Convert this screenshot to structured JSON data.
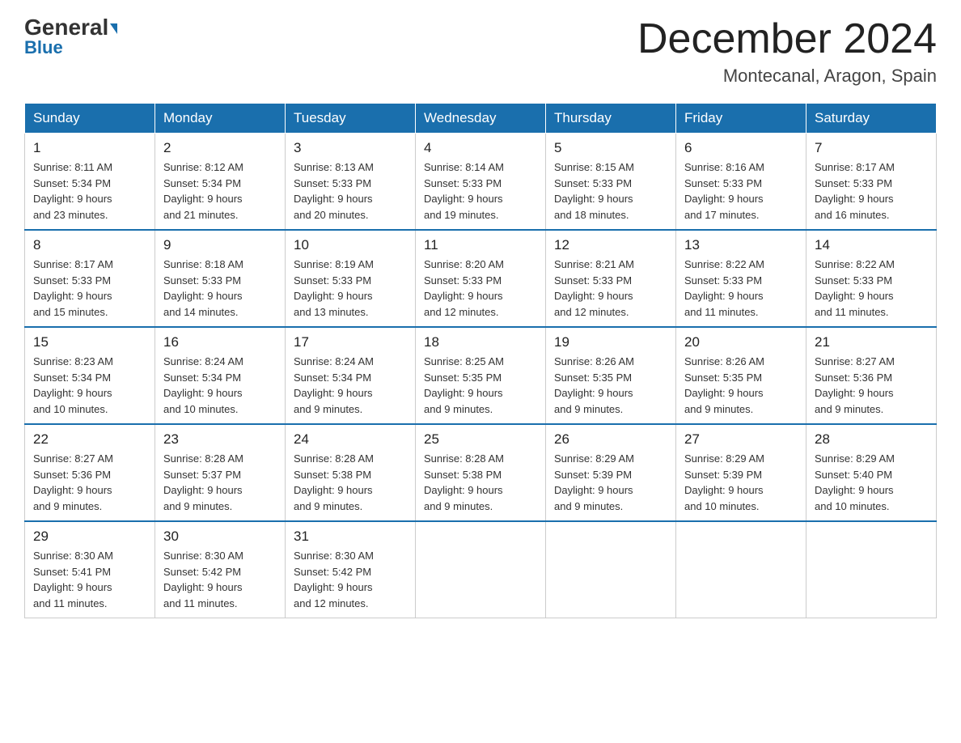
{
  "header": {
    "logo_general": "General",
    "logo_blue": "Blue",
    "month_title": "December 2024",
    "location": "Montecanal, Aragon, Spain"
  },
  "days_of_week": [
    "Sunday",
    "Monday",
    "Tuesday",
    "Wednesday",
    "Thursday",
    "Friday",
    "Saturday"
  ],
  "weeks": [
    [
      {
        "day": "1",
        "sunrise": "8:11 AM",
        "sunset": "5:34 PM",
        "daylight": "9 hours and 23 minutes."
      },
      {
        "day": "2",
        "sunrise": "8:12 AM",
        "sunset": "5:34 PM",
        "daylight": "9 hours and 21 minutes."
      },
      {
        "day": "3",
        "sunrise": "8:13 AM",
        "sunset": "5:33 PM",
        "daylight": "9 hours and 20 minutes."
      },
      {
        "day": "4",
        "sunrise": "8:14 AM",
        "sunset": "5:33 PM",
        "daylight": "9 hours and 19 minutes."
      },
      {
        "day": "5",
        "sunrise": "8:15 AM",
        "sunset": "5:33 PM",
        "daylight": "9 hours and 18 minutes."
      },
      {
        "day": "6",
        "sunrise": "8:16 AM",
        "sunset": "5:33 PM",
        "daylight": "9 hours and 17 minutes."
      },
      {
        "day": "7",
        "sunrise": "8:17 AM",
        "sunset": "5:33 PM",
        "daylight": "9 hours and 16 minutes."
      }
    ],
    [
      {
        "day": "8",
        "sunrise": "8:17 AM",
        "sunset": "5:33 PM",
        "daylight": "9 hours and 15 minutes."
      },
      {
        "day": "9",
        "sunrise": "8:18 AM",
        "sunset": "5:33 PM",
        "daylight": "9 hours and 14 minutes."
      },
      {
        "day": "10",
        "sunrise": "8:19 AM",
        "sunset": "5:33 PM",
        "daylight": "9 hours and 13 minutes."
      },
      {
        "day": "11",
        "sunrise": "8:20 AM",
        "sunset": "5:33 PM",
        "daylight": "9 hours and 12 minutes."
      },
      {
        "day": "12",
        "sunrise": "8:21 AM",
        "sunset": "5:33 PM",
        "daylight": "9 hours and 12 minutes."
      },
      {
        "day": "13",
        "sunrise": "8:22 AM",
        "sunset": "5:33 PM",
        "daylight": "9 hours and 11 minutes."
      },
      {
        "day": "14",
        "sunrise": "8:22 AM",
        "sunset": "5:33 PM",
        "daylight": "9 hours and 11 minutes."
      }
    ],
    [
      {
        "day": "15",
        "sunrise": "8:23 AM",
        "sunset": "5:34 PM",
        "daylight": "9 hours and 10 minutes."
      },
      {
        "day": "16",
        "sunrise": "8:24 AM",
        "sunset": "5:34 PM",
        "daylight": "9 hours and 10 minutes."
      },
      {
        "day": "17",
        "sunrise": "8:24 AM",
        "sunset": "5:34 PM",
        "daylight": "9 hours and 9 minutes."
      },
      {
        "day": "18",
        "sunrise": "8:25 AM",
        "sunset": "5:35 PM",
        "daylight": "9 hours and 9 minutes."
      },
      {
        "day": "19",
        "sunrise": "8:26 AM",
        "sunset": "5:35 PM",
        "daylight": "9 hours and 9 minutes."
      },
      {
        "day": "20",
        "sunrise": "8:26 AM",
        "sunset": "5:35 PM",
        "daylight": "9 hours and 9 minutes."
      },
      {
        "day": "21",
        "sunrise": "8:27 AM",
        "sunset": "5:36 PM",
        "daylight": "9 hours and 9 minutes."
      }
    ],
    [
      {
        "day": "22",
        "sunrise": "8:27 AM",
        "sunset": "5:36 PM",
        "daylight": "9 hours and 9 minutes."
      },
      {
        "day": "23",
        "sunrise": "8:28 AM",
        "sunset": "5:37 PM",
        "daylight": "9 hours and 9 minutes."
      },
      {
        "day": "24",
        "sunrise": "8:28 AM",
        "sunset": "5:38 PM",
        "daylight": "9 hours and 9 minutes."
      },
      {
        "day": "25",
        "sunrise": "8:28 AM",
        "sunset": "5:38 PM",
        "daylight": "9 hours and 9 minutes."
      },
      {
        "day": "26",
        "sunrise": "8:29 AM",
        "sunset": "5:39 PM",
        "daylight": "9 hours and 9 minutes."
      },
      {
        "day": "27",
        "sunrise": "8:29 AM",
        "sunset": "5:39 PM",
        "daylight": "9 hours and 10 minutes."
      },
      {
        "day": "28",
        "sunrise": "8:29 AM",
        "sunset": "5:40 PM",
        "daylight": "9 hours and 10 minutes."
      }
    ],
    [
      {
        "day": "29",
        "sunrise": "8:30 AM",
        "sunset": "5:41 PM",
        "daylight": "9 hours and 11 minutes."
      },
      {
        "day": "30",
        "sunrise": "8:30 AM",
        "sunset": "5:42 PM",
        "daylight": "9 hours and 11 minutes."
      },
      {
        "day": "31",
        "sunrise": "8:30 AM",
        "sunset": "5:42 PM",
        "daylight": "9 hours and 12 minutes."
      },
      null,
      null,
      null,
      null
    ]
  ]
}
